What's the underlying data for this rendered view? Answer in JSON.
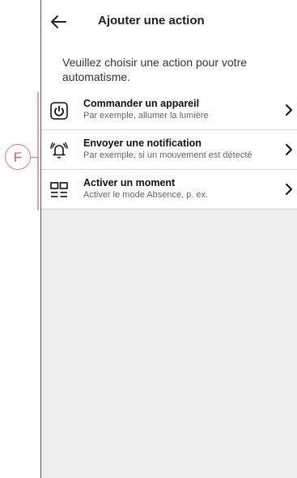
{
  "header": {
    "title": "Ajouter une action",
    "back_icon": "arrow-left-icon"
  },
  "intro": "Veuillez choisir une action pour votre automatisme.",
  "actions": [
    {
      "icon": "power-button-icon",
      "title": "Commander un appareil",
      "subtitle": "Par exemple, allumer la lumière"
    },
    {
      "icon": "ringing-bell-icon",
      "title": "Envoyer une notification",
      "subtitle": "Par exemple, si un mouvement est détecté"
    },
    {
      "icon": "grid-moment-icon",
      "title": "Activer un moment",
      "subtitle": "Activer le mode Absence, p. ex."
    }
  ],
  "callout": {
    "letter": "F",
    "color": "#e07a86"
  },
  "colors": {
    "background": "#efefef",
    "accent_marker": "#e8a0a8"
  }
}
